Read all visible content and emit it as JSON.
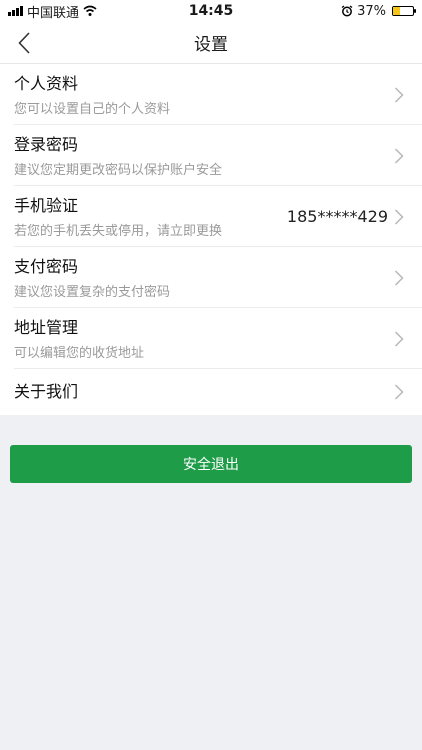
{
  "status_bar": {
    "carrier": "中国联通",
    "time": "14:45",
    "battery": "37%",
    "battery_level": 0.37
  },
  "nav": {
    "title": "设置"
  },
  "items": [
    {
      "title": "个人资料",
      "subtitle": "您可以设置自己的个人资料",
      "value": ""
    },
    {
      "title": "登录密码",
      "subtitle": "建议您定期更改密码以保护账户安全",
      "value": ""
    },
    {
      "title": "手机验证",
      "subtitle": "若您的手机丢失或停用，请立即更换",
      "value": "185*****429"
    },
    {
      "title": "支付密码",
      "subtitle": "建议您设置复杂的支付密码",
      "value": ""
    },
    {
      "title": "地址管理",
      "subtitle": "可以编辑您的收货地址",
      "value": ""
    },
    {
      "title": "关于我们",
      "subtitle": "",
      "value": ""
    }
  ],
  "logout_label": "安全退出",
  "colors": {
    "accent": "#1e9c48",
    "background": "#eff0f4",
    "subtitle": "#9a9a9a"
  }
}
